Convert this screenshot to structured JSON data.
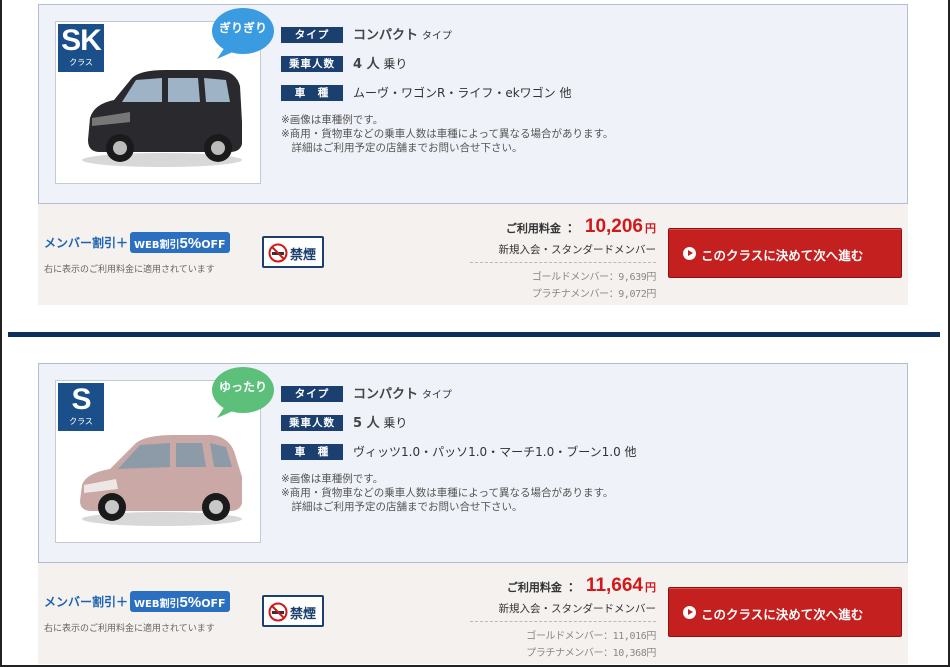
{
  "cards": [
    {
      "class_code": "SK",
      "class_sub": "クラス",
      "badge_text": "ぎりぎり",
      "badge_color": "#3b9be0",
      "car_color": "#2a2a2e",
      "specs": {
        "type_label": "タイプ",
        "type_value": "コンパクト",
        "type_suffix": "タイプ",
        "capacity_label": "乗車人数",
        "capacity_value": "4 人",
        "capacity_suffix": "乗り",
        "models_label": "車　種",
        "models_value": "ムーヴ・ワゴンR・ライフ・ekワゴン 他"
      },
      "notes": [
        "※画像は車種例です。",
        "※商用・貨物車などの乗車人数は車種によって異なる場合があります。",
        "　詳細はご利用予定の店舗までお問い合せ下さい。"
      ],
      "discount": {
        "member": "メンバー割引＋",
        "web": "WEB割引",
        "pct": "5%",
        "off": "OFF",
        "note": "右に表示のご利用料金に適用されています"
      },
      "no_smoking": "禁煙",
      "price": {
        "label": "ご利用料金",
        "colon": "：",
        "amount": "10,206",
        "unit": "円",
        "sub": "新規入会・スタンダードメンバー",
        "gold": "ゴールドメンバー：9,639円",
        "platinum": "プラチナメンバー：9,072円"
      },
      "cta": "このクラスに決めて次へ進む"
    },
    {
      "class_code": "S",
      "class_sub": "クラス",
      "badge_text": "ゆったり",
      "badge_color": "#5cc07a",
      "car_color": "#c9a8a6",
      "specs": {
        "type_label": "タイプ",
        "type_value": "コンパクト",
        "type_suffix": "タイプ",
        "capacity_label": "乗車人数",
        "capacity_value": "5 人",
        "capacity_suffix": "乗り",
        "models_label": "車　種",
        "models_value": "ヴィッツ1.0・パッソ1.0・マーチ1.0・ブーン1.0 他"
      },
      "notes": [
        "※画像は車種例です。",
        "※商用・貨物車などの乗車人数は車種によって異なる場合があります。",
        "　詳細はご利用予定の店舗までお問い合せ下さい。"
      ],
      "discount": {
        "member": "メンバー割引＋",
        "web": "WEB割引",
        "pct": "5%",
        "off": "OFF",
        "note": "右に表示のご利用料金に適用されています"
      },
      "no_smoking": "禁煙",
      "price": {
        "label": "ご利用料金",
        "colon": "：",
        "amount": "11,664",
        "unit": "円",
        "sub": "新規入会・スタンダードメンバー",
        "gold": "ゴールドメンバー：11,016円",
        "platinum": "プラチナメンバー：10,368円"
      },
      "cta": "このクラスに決めて次へ進む"
    }
  ]
}
